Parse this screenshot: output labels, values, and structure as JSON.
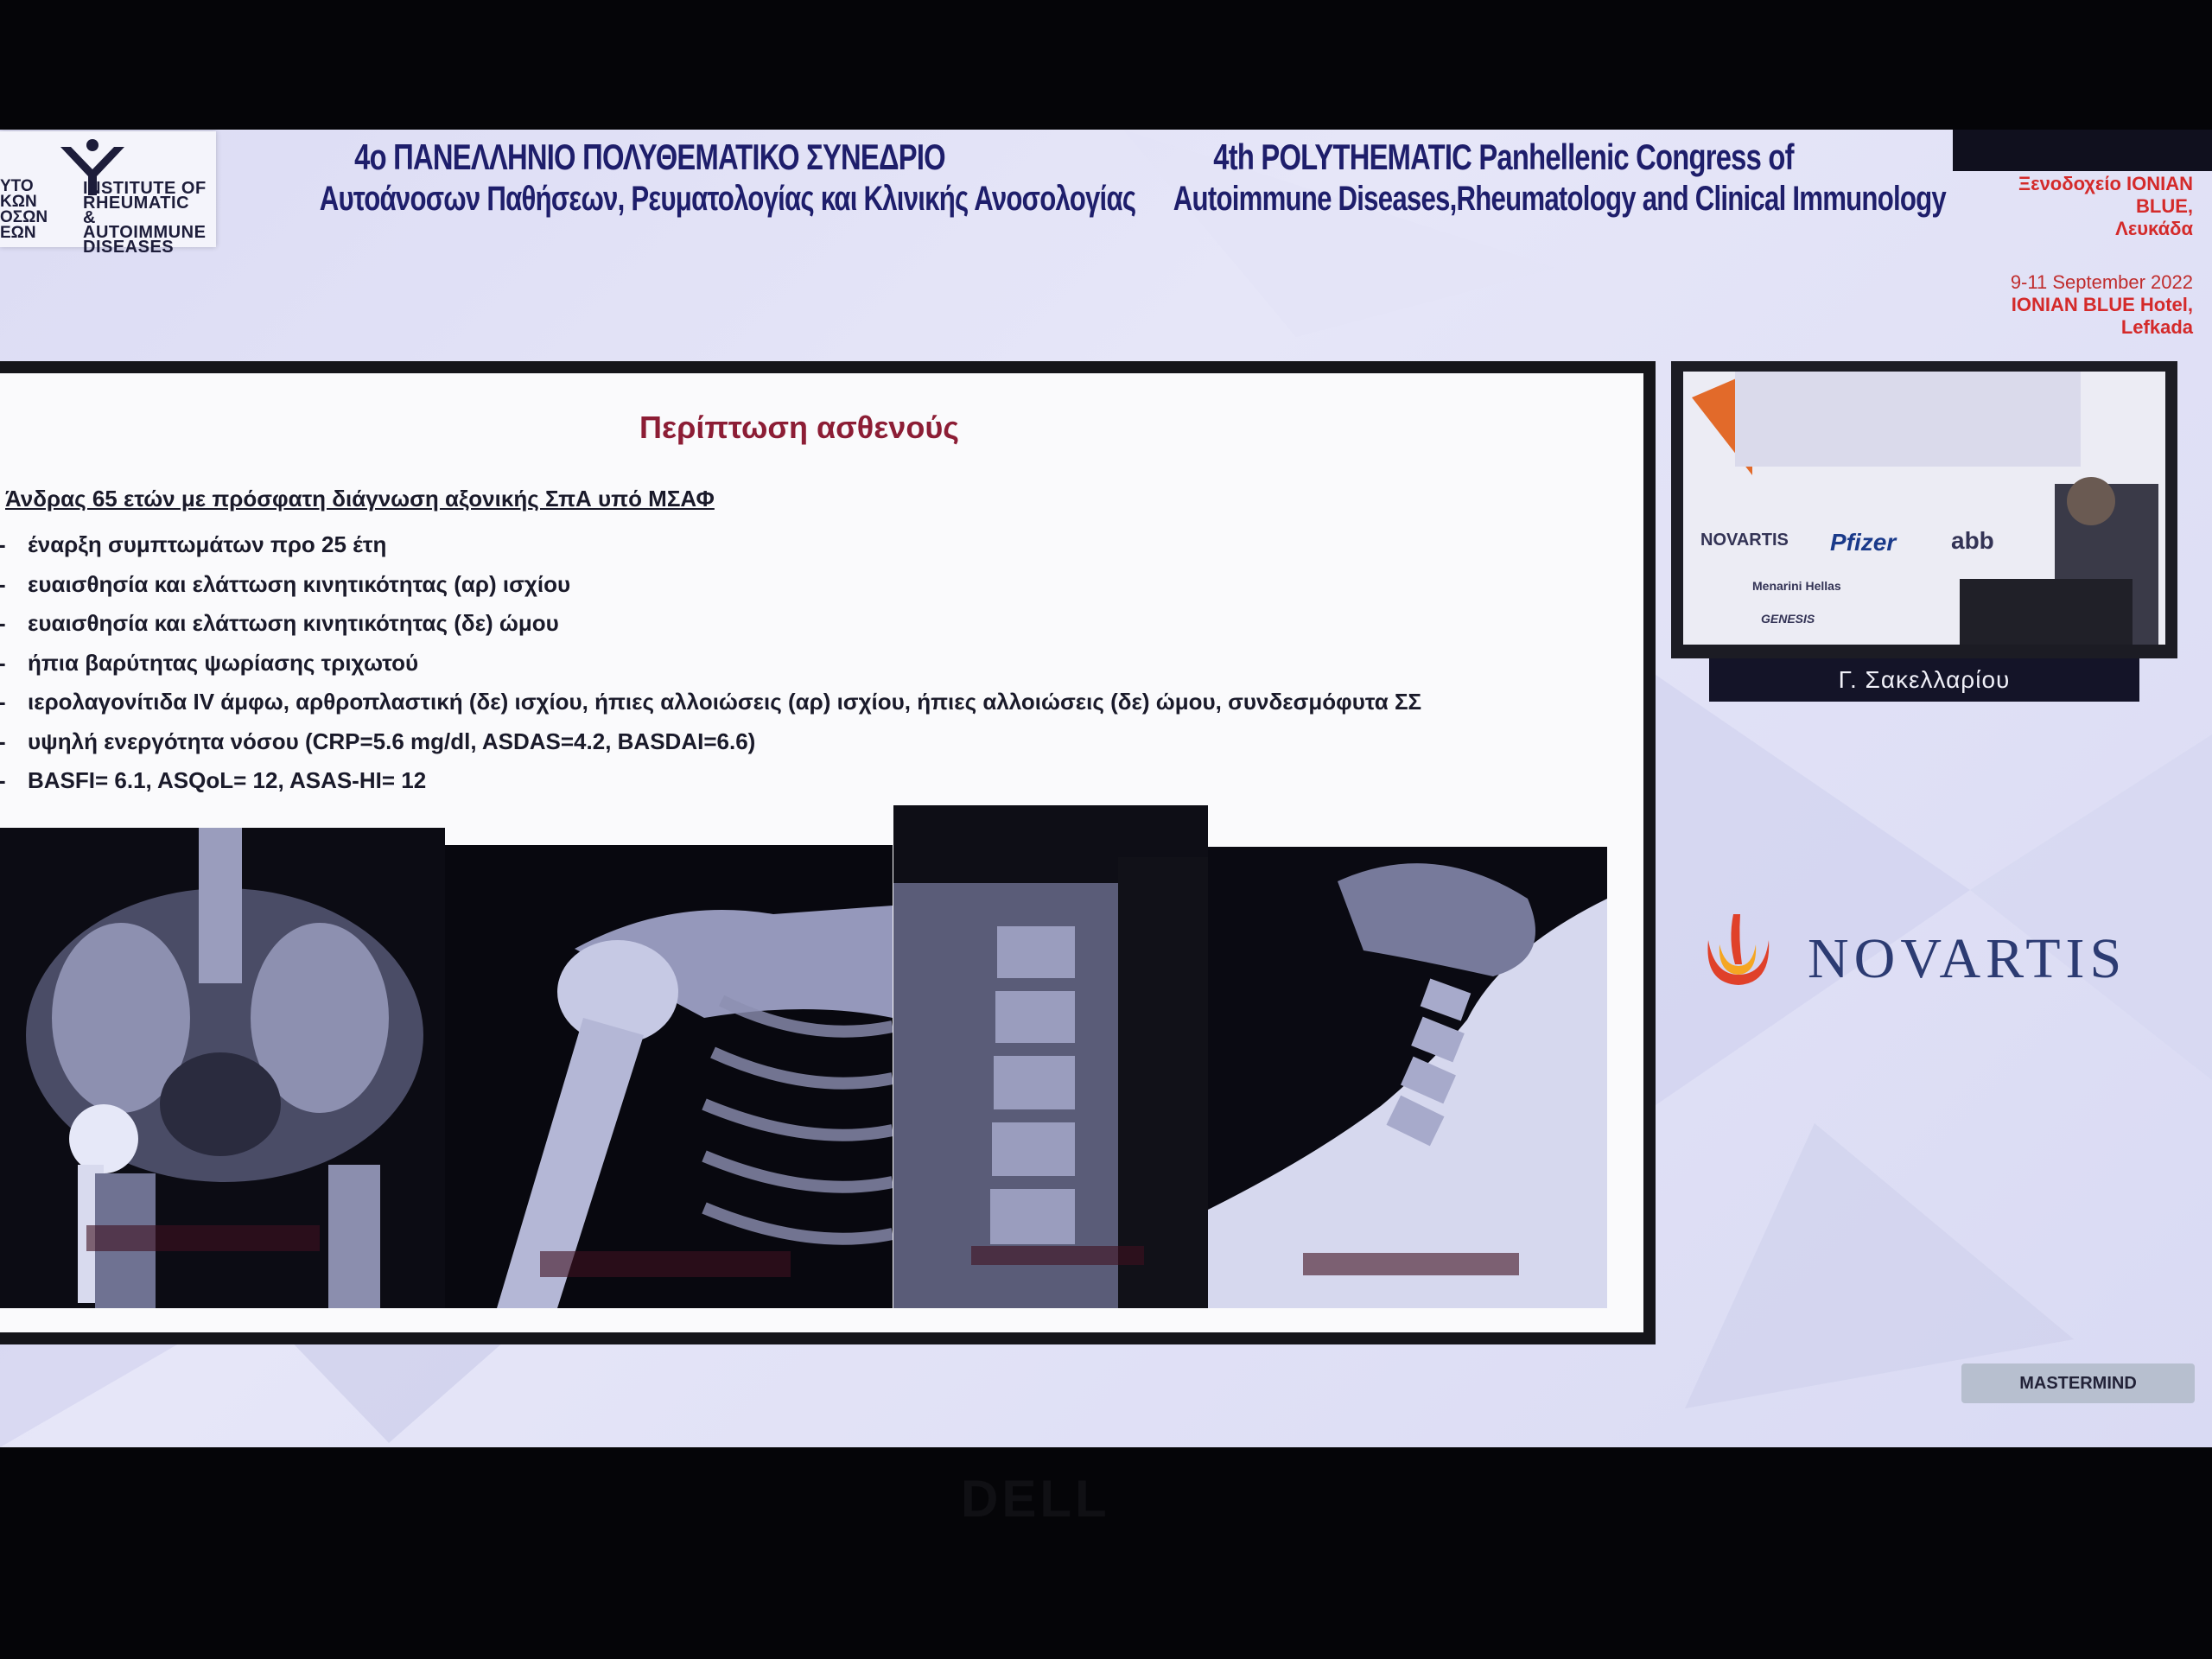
{
  "header": {
    "institute_left_lines": [
      "ΥΤΟ",
      "ΚΩΝ",
      "ΟΣΩΝ",
      "ΕΩΝ"
    ],
    "institute_right_lines": [
      "INSTITUTE OF",
      "RHEUMATIC",
      "& AUTOIMMUNE",
      "DISEASES"
    ],
    "congress_gr_line1": "4ο ΠΑΝΕΛΛΗΝΙΟ ΠΟΛΥΘΕΜΑΤΙΚΟ ΣΥΝΕΔΡΙΟ",
    "congress_gr_line2": "Αυτοάνοσων Παθήσεων, Ρευματολογίας και Κλινικής Ανοσολογίας",
    "congress_en_line1": "4th POLYTHEMATIC Panhellenic Congress of",
    "congress_en_line2": "Autoimmune Diseases,Rheumatology and Clinical Immunology",
    "venue_gr_line1": "Ξενοδοχείο IONIAN BLUE,",
    "venue_gr_line2": "Λευκάδα",
    "venue_dates": "9-11 September 2022",
    "venue_en_line1": "IONIAN BLUE Hotel,",
    "venue_en_line2": "Lefkada"
  },
  "slide": {
    "title": "Περίπτωση ασθενούς",
    "intro": "Άνδρας 65 ετών με πρόσφατη διάγνωση αξονικής ΣπΑ υπό ΜΣΑΦ",
    "bullet_marker": "-",
    "bullets": [
      "έναρξη συμπτωμάτων προ 25 έτη",
      "ευαισθησία και ελάττωση κινητικότητας (αρ) ισχίου",
      "ευαισθησία και ελάττωση κινητικότητας (δε) ώμου",
      "ήπια βαρύτητας ψωρίασης τριχωτού",
      "ιερολαγονίτιδα IV άμφω, αρθροπλαστική (δε) ισχίου, ήπιες αλλοιώσεις (αρ) ισχίου, ήπιες αλλοιώσεις (δε) ώμου, συνδεσμόφυτα ΣΣ",
      "υψηλή ενεργότητα νόσου (CRP=5.6 mg/dl, ASDAS=4.2, BASDAI=6.6)",
      "BASFI= 6.1, ASQoL= 12, ASAS-HI= 12"
    ],
    "xray_images": [
      "pelvis-xray",
      "shoulder-xray",
      "spine-xray",
      "cervical-spine-xray"
    ]
  },
  "video": {
    "speaker_name": "Γ. Σακελλαρίου",
    "sponsor_logos": [
      "NOVARTIS",
      "Pfizer",
      "abb",
      "Menarini Hellas",
      "GENESIS"
    ]
  },
  "sponsor": {
    "name": "NOVARTIS"
  },
  "footer": {
    "mastermind": "MASTERMIND"
  },
  "monitor": {
    "brand": "DELL"
  },
  "colors": {
    "slide_title": "#8c1d35",
    "header_text": "#1e1e6b",
    "venue_text": "#d42a2a",
    "novartis_blue": "#2c3b72"
  }
}
